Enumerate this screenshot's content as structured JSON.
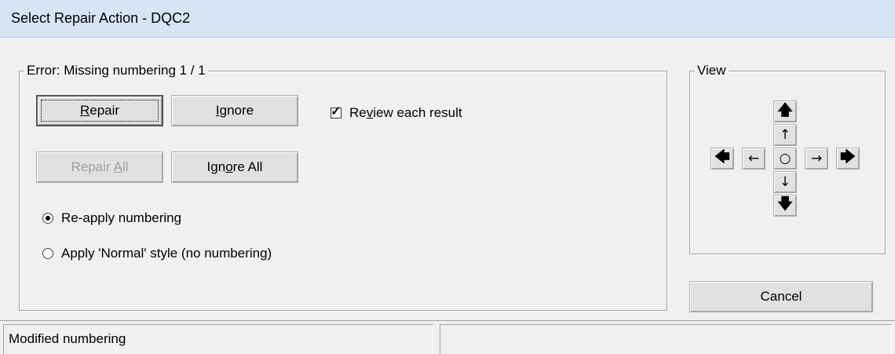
{
  "window": {
    "title": "Select Repair Action - DQC2"
  },
  "error_group": {
    "legend": "Error: Missing numbering  1 / 1",
    "repair_button": {
      "pre": "",
      "key": "R",
      "post": "epair"
    },
    "ignore_button": {
      "pre": "",
      "key": "I",
      "post": "gnore"
    },
    "review_checkbox": {
      "pre": "Re",
      "key": "v",
      "post": "iew each result",
      "checked": true
    },
    "repair_all_button": {
      "pre": "Repair ",
      "key": "A",
      "post": "ll",
      "enabled": false
    },
    "ignore_all_button": {
      "pre": "Ign",
      "key": "o",
      "post": "re All"
    },
    "options": [
      {
        "label": "Re-apply numbering",
        "selected": true
      },
      {
        "label": "Apply 'Normal' style (no numbering)",
        "selected": false
      }
    ]
  },
  "view_group": {
    "legend": "View",
    "arrows": {
      "up_big": "🡅",
      "up": "↑",
      "left_big": "🡄",
      "left": "←",
      "center": "○",
      "right": "→",
      "right_big": "🡆",
      "down": "↓",
      "down_big": "🡇"
    }
  },
  "cancel_button": {
    "label": "Cancel"
  },
  "status": {
    "left": "Modified numbering",
    "right": ""
  }
}
